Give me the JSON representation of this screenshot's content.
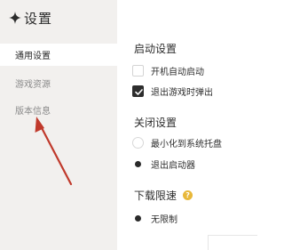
{
  "sidebar": {
    "title": "设置",
    "items": [
      {
        "label": "通用设置",
        "active": true
      },
      {
        "label": "游戏资源",
        "active": false
      },
      {
        "label": "版本信息",
        "active": false
      }
    ]
  },
  "main": {
    "startup": {
      "title": "启动设置",
      "options": [
        {
          "label": "开机自动启动",
          "checked": false
        },
        {
          "label": "退出游戏时弹出",
          "checked": true
        }
      ]
    },
    "close": {
      "title": "关闭设置",
      "options": [
        {
          "label": "最小化到系统托盘",
          "selected": false
        },
        {
          "label": "退出启动器",
          "selected": true
        }
      ]
    },
    "download": {
      "title": "下载限速",
      "help_glyph": "?",
      "options": [
        {
          "label": "无限制",
          "selected": true
        }
      ]
    }
  },
  "colors": {
    "sidebar_bg": "#f2f0ee",
    "arrow": "#c0392b",
    "help": "#e8b83a"
  },
  "icons": {
    "title": "sparkle-icon",
    "checkbox_checked": "checkmark-icon"
  }
}
